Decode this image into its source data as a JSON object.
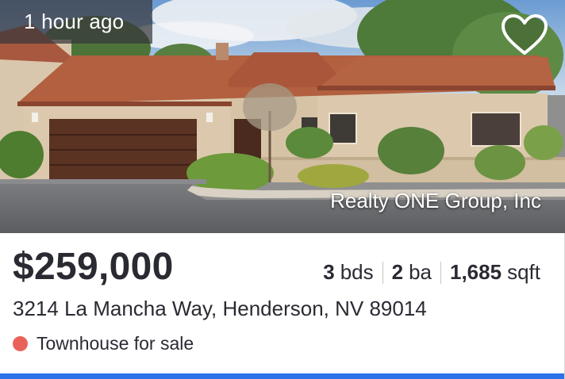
{
  "listing": {
    "posted": "1 hour ago",
    "favorite_icon": "heart-outline-icon",
    "brokerage": "Realty ONE Group, Inc",
    "price": "$259,000",
    "facts": {
      "beds_value": "3",
      "beds_unit": "bds",
      "baths_value": "2",
      "baths_unit": "ba",
      "sqft_value": "1,685",
      "sqft_unit": "sqft"
    },
    "address": "3214 La Mancha Way, Henderson, NV 89014",
    "status": "Townhouse for sale"
  },
  "colors": {
    "status_dot": "#e9625a",
    "accent_bar": "#2a73e8",
    "text": "#2a2a33"
  }
}
